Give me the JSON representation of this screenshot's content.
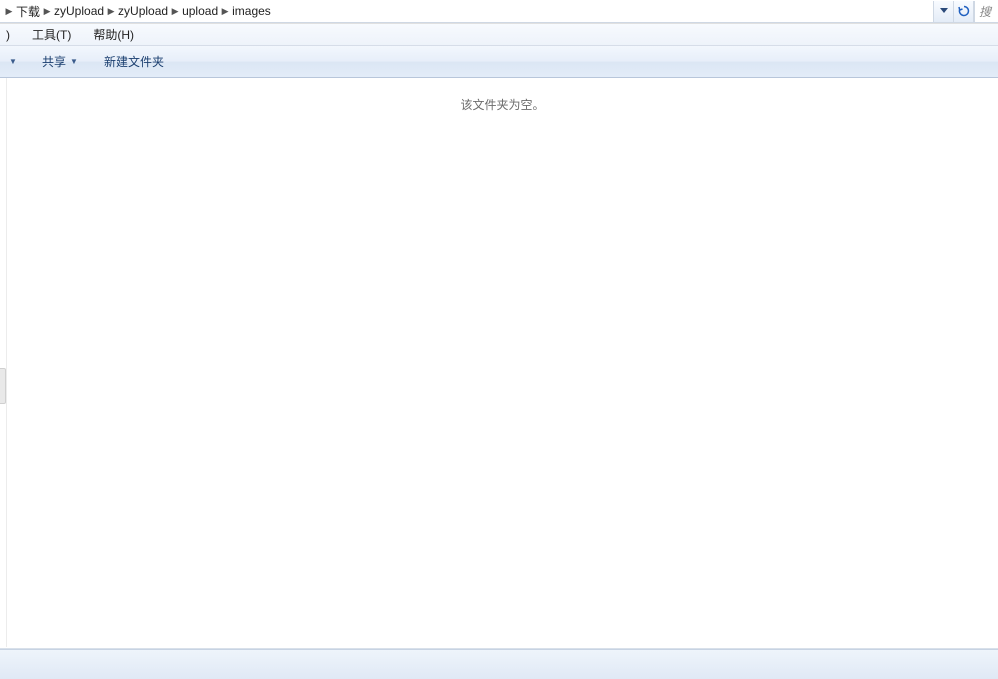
{
  "breadcrumb": {
    "items": [
      "下载",
      "zyUpload",
      "zyUpload",
      "upload",
      "images"
    ]
  },
  "search": {
    "placeholder": "搜"
  },
  "menu": {
    "item0": ")",
    "item1": "工具(T)",
    "item2": "帮助(H)"
  },
  "toolbar": {
    "share": "共享",
    "newfolder": "新建文件夹"
  },
  "content": {
    "empty_message": "该文件夹为空。"
  }
}
